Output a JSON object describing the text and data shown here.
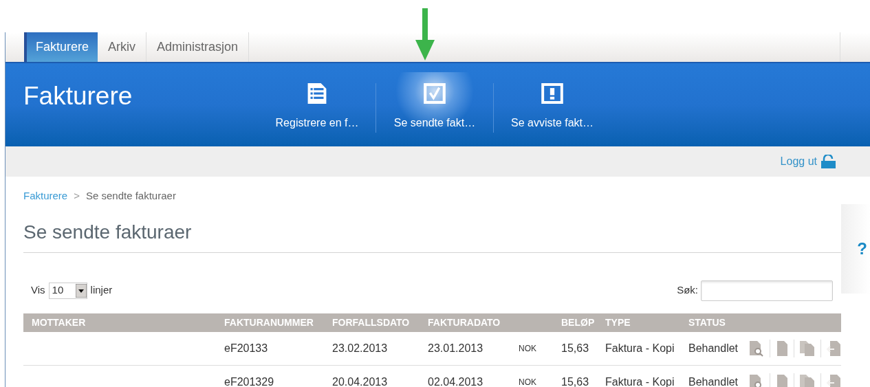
{
  "tabs": [
    {
      "label": "Fakturere",
      "selected": true
    },
    {
      "label": "Arkiv",
      "selected": false
    },
    {
      "label": "Administrasjon",
      "selected": false
    }
  ],
  "header": {
    "title": "Fakturere",
    "actions": [
      {
        "label": "Registrere en f…",
        "kind": "list",
        "selected": false
      },
      {
        "label": "Se sendte fakt…",
        "kind": "check",
        "selected": true
      },
      {
        "label": "Se avviste fakt…",
        "kind": "alert",
        "selected": false
      }
    ]
  },
  "logout": "Logg ut",
  "breadcrumb": [
    {
      "label": "Fakturere",
      "kind": "link"
    },
    {
      "label": "Se sendte fakturaer",
      "kind": "current"
    }
  ],
  "breadcrumb_separator": ">",
  "page_title": "Se sendte fakturaer",
  "help": "?",
  "show_entries": {
    "prefix": "Vis",
    "value": "10",
    "suffix": "linjer"
  },
  "search": {
    "label": "Søk:"
  },
  "table": {
    "columns": [
      "MOTTAKER",
      "FAKTURANUMMER",
      "FORFALLSDATO",
      "FAKTURADATO",
      "BELØP",
      "TYPE",
      "STATUS"
    ],
    "rows": [
      {
        "fakturanummer": "eF20133",
        "forfallsdato": "23.02.2013",
        "fakturadato": "23.01.2013",
        "currency": "NOK",
        "belop": "15,63",
        "type": "Faktura - Kopi",
        "status": "Behandlet"
      },
      {
        "fakturanummer": "eF201329",
        "forfallsdato": "20.04.2013",
        "fakturadato": "02.04.2013",
        "currency": "NOK",
        "belop": "15,63",
        "type": "Faktura - Kopi",
        "status": "Behandlet"
      }
    ]
  }
}
